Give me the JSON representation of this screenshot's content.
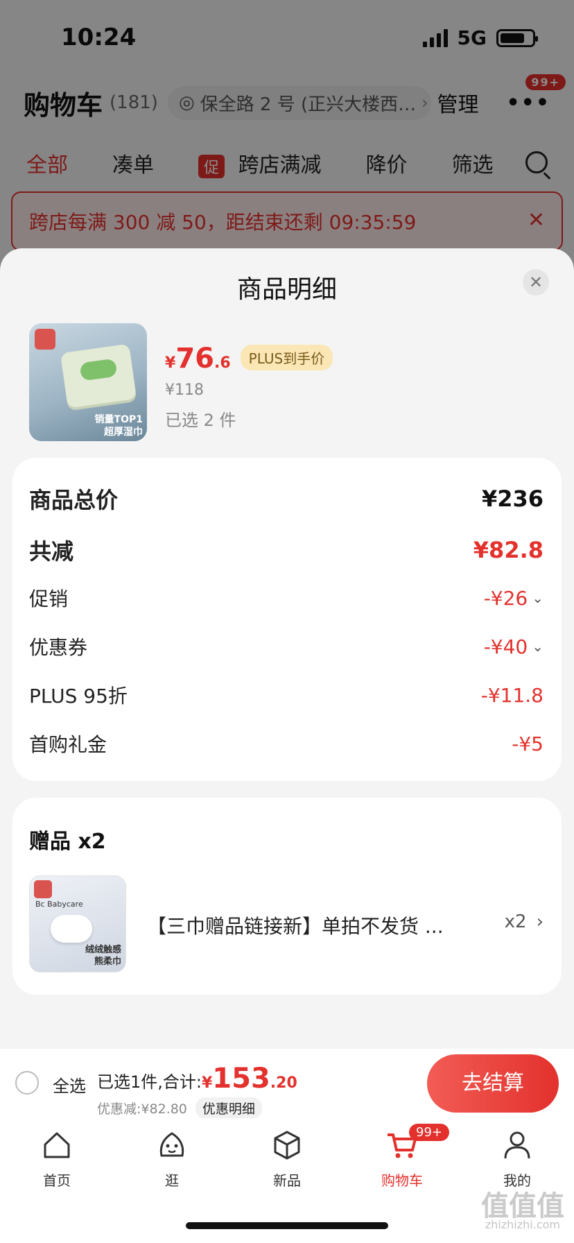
{
  "status": {
    "time": "10:24",
    "network": "5G"
  },
  "cart_header": {
    "title": "购物车",
    "count": "(181)",
    "address": "保全路 2 号 (正兴大楼西…",
    "manage": "管理",
    "more_badge": "99+"
  },
  "filters": {
    "items": [
      "全部",
      "凑单",
      "跨店满减",
      "降价",
      "筛选"
    ],
    "promo_tag": "促"
  },
  "banner": {
    "text": "跨店每满 300 减 50，距结束还剩 09:35:59"
  },
  "sheet": {
    "title": "商品明细",
    "product": {
      "price_symbol": "¥",
      "price_int": "76",
      "price_dec": ".6",
      "plus_tag": "PLUS到手价",
      "original_price": "¥118",
      "selected": "已选 2 件",
      "image_caption_1": "销量TOP1",
      "image_caption_2": "超厚湿巾"
    },
    "price_details": {
      "total_label": "商品总价",
      "total_value": "¥236",
      "reduce_label": "共减",
      "reduce_value": "¥82.8",
      "rows": [
        {
          "label": "促销",
          "value": "-¥26"
        },
        {
          "label": "优惠券",
          "value": "-¥40"
        },
        {
          "label": "PLUS 95折",
          "value": "-¥11.8"
        },
        {
          "label": "首购礼金",
          "value": "-¥5"
        }
      ]
    },
    "gifts": {
      "title": "赠品 x2",
      "item_name": "【三巾赠品链接新】单拍不发货 ...",
      "item_qty": "x2",
      "image_brand": "Bc Babycare",
      "image_caption_1": "绒绒触感",
      "image_caption_2": "熊柔巾"
    }
  },
  "checkout": {
    "select_all": "全选",
    "total_label": "已选1件,合计:",
    "total_symbol": "¥",
    "total_int": "153",
    "total_dec": ".20",
    "discount_text": "优惠减:¥82.80",
    "discount_detail": "优惠明细",
    "pay_button": "去结算"
  },
  "tabs": [
    {
      "label": "首页",
      "icon": "home-icon"
    },
    {
      "label": "逛",
      "icon": "browse-face-icon"
    },
    {
      "label": "新品",
      "icon": "box-icon"
    },
    {
      "label": "购物车",
      "icon": "cart-icon",
      "badge": "99+"
    },
    {
      "label": "我的",
      "icon": "user-icon"
    }
  ],
  "watermark": {
    "main": "值值值",
    "sub": "zhizhizhi.com"
  },
  "colors": {
    "accent": "#e3312d",
    "plus_tag_bg": "#fbe7b5"
  }
}
